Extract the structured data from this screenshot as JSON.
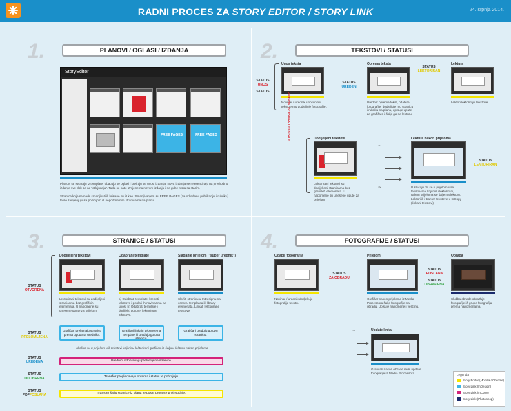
{
  "header": {
    "title_prefix": "RADNI PROCES ZA ",
    "title_italic": "STORY EDITOR / STORY LINK",
    "date": "24. srpnja 2014."
  },
  "q1": {
    "number": "1.",
    "title": "PLANOVI / OGLASI / IZDANJA",
    "app_title": "StoryEditor",
    "free_pages": "FREE PAGES",
    "desc1": "Planovi se stvaraju iz template, ubacuju se oglasi i kreiraju se unosi izdanja. Nova izdanja se referenciraju na prethodno izdanje sve dok se ne \"otkljucaju\". Tada se nate izmjene na novom izdanju i ne gube nista sa starim.",
    "desc2": "Stranice koje se nade smanjivati ili brisane su iz kao. Smanjivanjem su FREE PAGES (za odredenu publikaciju i rubriku) te se zamjenjuju sa pozicijom iz nepodmetnim stranicama na planu."
  },
  "q2": {
    "number": "2.",
    "title": "TEKSTOVI / STATUSI",
    "step1_label": "Unos teksta",
    "step2_label": "Oprema teksta",
    "step3_label": "Lektura",
    "step4_label": "Dodijeljeni tekstovi",
    "step5_label": "Lektura nakon prijeloma",
    "status_unos": "UNOS",
    "status_uredjen": "UREDEN",
    "status_lektoriran": "LEKTORIRAN",
    "status_word": "STATUS",
    "status_stranica_otvorena": "STATUS STRANICE: OTVORENA",
    "step1_text": "Novinar / urednik unosi novi tekst te mu dodjeljuje fotografije.",
    "step2_text": "Urednik oprema tekst, odabire fotografije, dodjeljuje mu stranicu i rubriku na planu, upisuje upute za grafičara i šalje ga na lekturu.",
    "step3_text": "Lektori lektoriraju tekstove.",
    "step4_text": "Lektorirani tekstovi su dodijeljeni stranicama bez grafičkih elemenata. U napomene su unesene upute za prijelom.",
    "step5_text": "U slučaju da se u prijelom ulile tekstovima koji nisu lektorirani, nakon prijeloma se šalje na lekturu. Lektori ili i tranfer tekstove u InCopy (linkani tekstovi)."
  },
  "q3": {
    "number": "3.",
    "title": "STRANICE / STATUSI",
    "step1_label": "Dodijeljeni tekstovi",
    "step2_label": "Odabrani template",
    "step3_label": "Slaganje prijelom (\"super urednik\")",
    "step1_text": "Lektorirani tekstovi su dodijeljeni stranicama bez grafičkih elemenata. U napomene su unesene upute za prijelom.",
    "step2_text": "a) Odabrati template, kreirati tekstove i poslati ih novinarima na unos. b) Odabrati template i dodijeliti gotove, lektorirane tekstove.",
    "step3_text": "Složiti stranicu u InDesignu na osnovu templatea ili library elemenata. Linkati lektorirane tekstove.",
    "status_word": "STATUS",
    "status_otvorena": "OTVORENA",
    "status_prelomljena": "PRELOMLJENA",
    "status_uredjena": "UREĐENA",
    "status_odobrena": "ODOBRENA",
    "status_pdf": "PDF",
    "status_poslana": "POSLANA",
    "box1": "Grafičari prelamaju stranicu prema uputama urednika.",
    "box2": "Grafičari linkaju tekstove na template ili uređuju gotova stranicu.",
    "box3": "Grafičari uređuju gotovu stranicu.",
    "note": "- ukoliko su u prijelom ulili tekstovi koji nisu lektorirani grafičari ih šalju u lekturu nakon prijeloma -",
    "flow1": "Urednici odobravaju prelomljene stranice.",
    "flow2": "Transfer pregledavaju oprema i status te pohrajuju.",
    "flow3": "Transfer šalju stranice iz plana te poste procese proizvodnje."
  },
  "q4": {
    "number": "4.",
    "title": "FOTOGRAFIJE / STATUSI",
    "step1_label": "Odabir fotografija",
    "step2_label": "Prijelom",
    "step3_label": "Obrada",
    "step4_label": "Update linka",
    "status_word": "STATUS",
    "status_za_obradu": "ZA OBRADU",
    "status_poslana": "POSLANA",
    "status_obradena": "OBRAĐENA",
    "step1_text": "Novinar / urednik dodjeljuje fotografije tekstu.",
    "step2_text": "Grafičar nakon prijeloma iz Media Processora šalje fotografije na obradu. Upisuje napomene i veličinu.",
    "step3_text": "Služba obrade obrađuje fotografije iš grupe fotografija prema napomenama.",
    "step4_text": "Grafičari nakon obrade rade update fotografije iz Media Processora."
  },
  "legend": {
    "title": "Legenda",
    "items": [
      {
        "label": "Story Editor (Mozilla / Chrome)",
        "color": "#f5e500"
      },
      {
        "label": "Story Link (InDesign)",
        "color": "#3cb4e6"
      },
      {
        "label": "Story Link (InCopy)",
        "color": "#d4237a"
      },
      {
        "label": "Story Link (Photoshop)",
        "color": "#1a2a6c"
      }
    ]
  }
}
